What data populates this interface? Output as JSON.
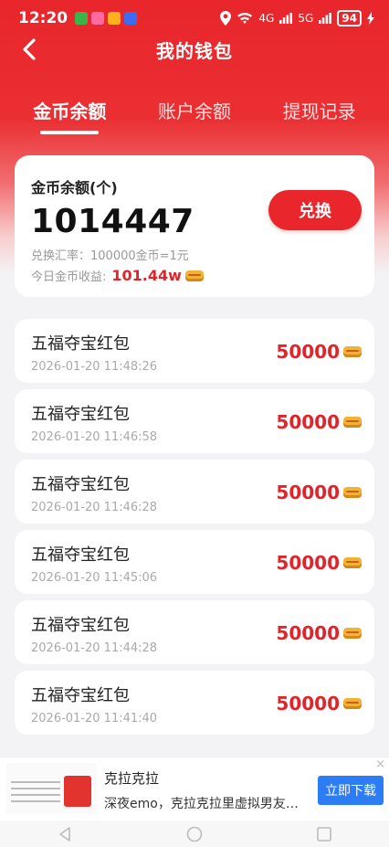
{
  "status_bar": {
    "time": "12:20",
    "signal1": "4G",
    "signal2": "5G",
    "battery": "94"
  },
  "header": {
    "title": "我的钱包"
  },
  "tabs": [
    {
      "label": "金币余额",
      "active": true
    },
    {
      "label": "账户余额",
      "active": false
    },
    {
      "label": "提现记录",
      "active": false
    }
  ],
  "balance": {
    "label": "金币余额(个)",
    "value": "1014447",
    "exchange_rate": "兑换汇率：100000金币=1元",
    "today_label": "今日金币收益:",
    "today_value": "101.44w",
    "exchange_button": "兑换"
  },
  "records": [
    {
      "title": "五福夺宝红包",
      "time": "2026-01-20 11:48:26",
      "amount": "50000"
    },
    {
      "title": "五福夺宝红包",
      "time": "2026-01-20 11:46:58",
      "amount": "50000"
    },
    {
      "title": "五福夺宝红包",
      "time": "2026-01-20 11:46:28",
      "amount": "50000"
    },
    {
      "title": "五福夺宝红包",
      "time": "2026-01-20 11:45:06",
      "amount": "50000"
    },
    {
      "title": "五福夺宝红包",
      "time": "2026-01-20 11:44:28",
      "amount": "50000"
    },
    {
      "title": "五福夺宝红包",
      "time": "2026-01-20 11:41:40",
      "amount": "50000"
    }
  ],
  "ad": {
    "title": "克拉克拉",
    "description": "深夜emo，克拉克拉里虚拟男友…",
    "button": "立即下载",
    "close": "×"
  },
  "colors": {
    "primary_red": "#e8262b",
    "amount_red": "#e2242a",
    "ad_blue": "#2b7cf5"
  }
}
